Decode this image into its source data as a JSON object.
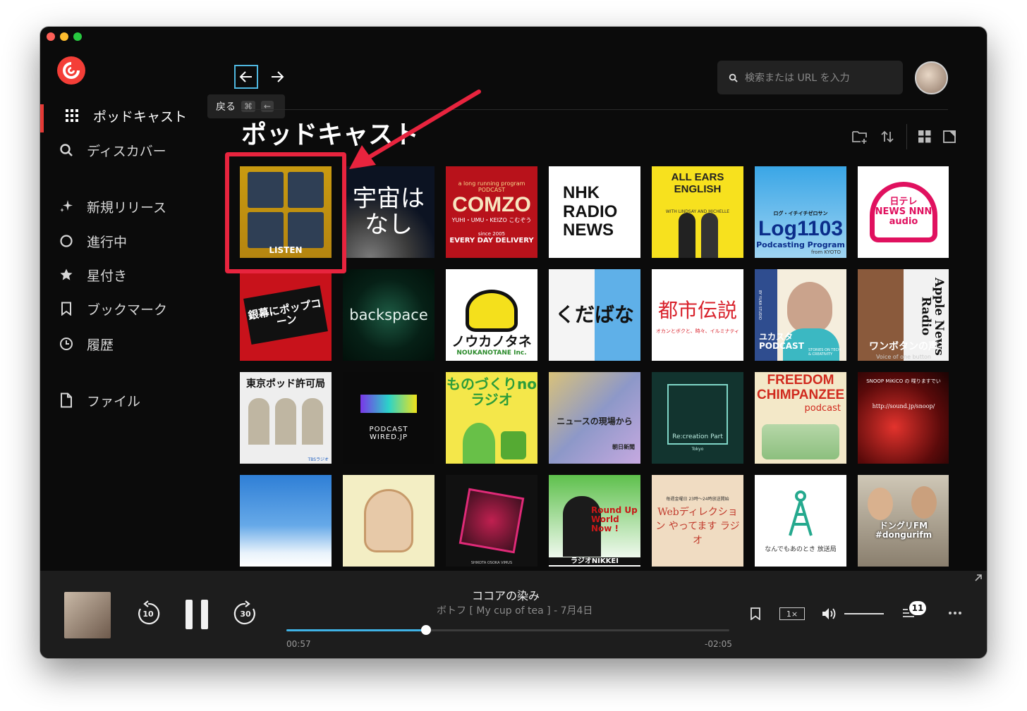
{
  "sidebar": {
    "items": [
      {
        "label": "ポッドキャスト",
        "icon": "grid-icon"
      },
      {
        "label": "ディスカバー",
        "icon": "search-icon"
      },
      {
        "label": "新規リリース",
        "icon": "sparkle-icon"
      },
      {
        "label": "進行中",
        "icon": "progress-circle-icon"
      },
      {
        "label": "星付き",
        "icon": "star-icon"
      },
      {
        "label": "ブックマーク",
        "icon": "bookmark-icon"
      },
      {
        "label": "履歴",
        "icon": "clock-icon"
      },
      {
        "label": "ファイル",
        "icon": "file-icon"
      }
    ]
  },
  "header": {
    "tooltip_label": "戻る",
    "tooltip_key1": "⌘",
    "tooltip_key2": "←",
    "search_placeholder": "検索または URL を入力",
    "page_title": "ポッドキャスト"
  },
  "podcasts": [
    {
      "title": "LISTEN"
    },
    {
      "title": "宇宙はなし"
    },
    {
      "title": "COMZO",
      "line2": "a long running program PODCAST",
      "line3": "YUHI・UMU・KEIZO こむぞう",
      "line4": "since 2005",
      "line5": "EVERY DAY DELIVERY"
    },
    {
      "title": "NHK RADIO NEWS"
    },
    {
      "title": "ALL EARS ENGLISH",
      "line2": "WITH LINDSAY AND MICHELLE"
    },
    {
      "title": "Log1103",
      "line2": "ログ・イチイチゼロサン",
      "line3": "Podcasting Program",
      "line4": "from KYOTO"
    },
    {
      "title": "日テレNEWS NNN audio"
    },
    {
      "title": "銀幕にポップコーン"
    },
    {
      "title": "backspace"
    },
    {
      "title": "ノウカノタネ",
      "line2": "NOUKANOTANE Inc."
    },
    {
      "title": "くだばな"
    },
    {
      "title": "都市伝説",
      "line2": "オカンとボクと、時々、イルミナティ"
    },
    {
      "title": "ユカスタ PODCAST",
      "line2": "STORIES ON TECH & CREATIVITY",
      "line3": "BY YUKA STUDIO"
    },
    {
      "title": "Apple News Radio",
      "line2": "ワンボタンの声",
      "line3": "Voice of one button"
    },
    {
      "title": "東京ポッド許可局",
      "line2": "TBSラジオ"
    },
    {
      "title": "PODCAST WIRED.JP"
    },
    {
      "title": "ものづくりnoラジオ"
    },
    {
      "title": "ニュースの現場から",
      "line2": "朝日新聞"
    },
    {
      "title": "Re:creation Part",
      "line2": "Tokyo"
    },
    {
      "title": "FREEDOM CHIMPANZEE",
      "line2": "podcast"
    },
    {
      "title": "http://sound.jp/snoop/",
      "line2": "SNOOP MiKiCO の 喋りますでい"
    },
    {
      "title": ""
    },
    {
      "title": ""
    },
    {
      "title": "SHIKOTA OSOKA VIMUS"
    },
    {
      "title": "Round Up World Now !",
      "line2": "ラジオNIKKEI"
    },
    {
      "title": "Webディレクション やってます ラジオ",
      "line2": "毎週金曜日 23時〜24時放送開始"
    },
    {
      "title": "なんでもあのとき 放送局"
    },
    {
      "title": "ドングリFM #dongurifm"
    }
  ],
  "player": {
    "title": "ココアの染み",
    "subtitle": "ボトフ [ My cup of tea ] - 7月4日",
    "elapsed": "00:57",
    "remaining": "-02:05",
    "progress": 0.315,
    "skip_back": "10",
    "skip_forward": "30",
    "speed": "1×",
    "queue_count": "11"
  }
}
